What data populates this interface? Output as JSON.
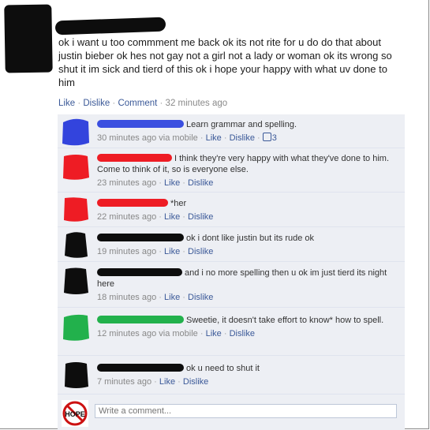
{
  "post": {
    "text": "ok i want u too commment me back ok its not rite for u do do that about justin bieber ok hes not gay not a girl not a lady or woman ok its wrong so shut it im sick and tierd of this ok i hope your happy with what uv done to him",
    "actions": {
      "like": "Like",
      "dislike": "Dislike",
      "comment": "Comment",
      "time": "32 minutes ago"
    }
  },
  "comments": [
    {
      "text": "Learn grammar and spelling.",
      "time": "30 minutes ago via mobile",
      "like": "Like",
      "dislike": "Dislike",
      "likes_count": "3",
      "avatar_color": "#3344dd",
      "scribble_color": "#3b4fe0"
    },
    {
      "text": "I think they're very happy with what they've done to him. Come to think of it, so is everyone else.",
      "time": "23 minutes ago",
      "like": "Like",
      "dislike": "Dislike",
      "avatar_color": "#ee1c24",
      "scribble_color": "#ee1c24"
    },
    {
      "text": "*her",
      "time": "22 minutes ago",
      "like": "Like",
      "dislike": "Dislike",
      "avatar_color": "#ee1c24",
      "scribble_color": "#ee1c24"
    },
    {
      "text": "ok i dont like justin but its rude ok",
      "time": "19 minutes ago",
      "like": "Like",
      "dislike": "Dislike",
      "avatar_color": "#0d0d0d",
      "scribble_color": "#0d0d0d"
    },
    {
      "text": "and i no more spelling then u ok im just tierd its night here",
      "time": "18 minutes ago",
      "like": "Like",
      "dislike": "Dislike",
      "avatar_color": "#0d0d0d",
      "scribble_color": "#0d0d0d"
    },
    {
      "text": "Sweetie, it doesn't take effort to know* how to spell.",
      "time": "12 minutes ago via mobile",
      "like": "Like",
      "dislike": "Dislike",
      "avatar_color": "#22b14c",
      "scribble_color": "#22b14c"
    },
    {
      "text": "ok u need to shut it",
      "time": "7 minutes ago",
      "like": "Like",
      "dislike": "Dislike",
      "avatar_color": "#0d0d0d",
      "scribble_color": "#0d0d0d"
    }
  ],
  "composer": {
    "placeholder": "Write a comment...",
    "avatar_label": "HOPE"
  }
}
